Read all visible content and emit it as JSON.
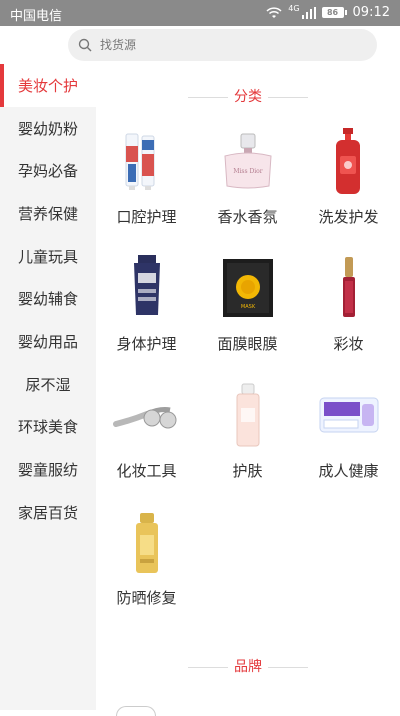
{
  "status_bar": {
    "carrier": "中国电信",
    "network": "4G",
    "battery": "86",
    "time": "09:12"
  },
  "search": {
    "placeholder": "找货源"
  },
  "sidebar": {
    "items": [
      {
        "label": "美妆个护",
        "active": true
      },
      {
        "label": "婴幼奶粉"
      },
      {
        "label": "孕妈必备"
      },
      {
        "label": "营养保健"
      },
      {
        "label": "儿童玩具"
      },
      {
        "label": "婴幼辅食"
      },
      {
        "label": "婴幼用品"
      },
      {
        "label": "尿不湿"
      },
      {
        "label": "环球美食"
      },
      {
        "label": "婴童服纺"
      },
      {
        "label": "家居百货"
      }
    ]
  },
  "main": {
    "category_title": "分类",
    "brand_title": "品牌",
    "categories": [
      {
        "label": "口腔护理",
        "icon": "toothpaste-icon"
      },
      {
        "label": "香水香氛",
        "icon": "perfume-icon"
      },
      {
        "label": "洗发护发",
        "icon": "shampoo-icon"
      },
      {
        "label": "身体护理",
        "icon": "lotion-tube-icon"
      },
      {
        "label": "面膜眼膜",
        "icon": "face-mask-box-icon"
      },
      {
        "label": "彩妆",
        "icon": "lip-gloss-icon"
      },
      {
        "label": "化妆工具",
        "icon": "face-roller-icon"
      },
      {
        "label": "护肤",
        "icon": "toner-bottle-icon"
      },
      {
        "label": "成人健康",
        "icon": "pad-pack-icon"
      },
      {
        "label": "防晒修复",
        "icon": "sunscreen-icon"
      }
    ]
  },
  "colors": {
    "accent": "#e4393c",
    "sidebar_bg": "#f4f4f4",
    "status_bar": "#8a8a8a"
  }
}
